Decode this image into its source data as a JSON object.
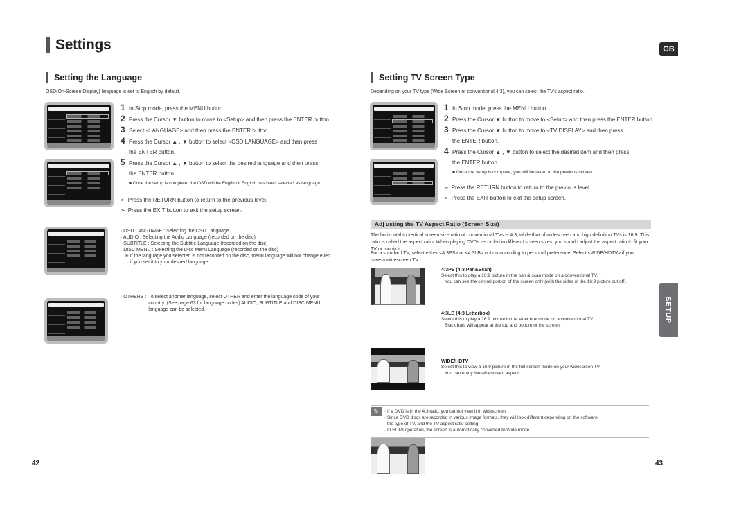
{
  "page": {
    "title": "Settings",
    "region_badge": "GB",
    "side_tab": "SETUP",
    "page_left": "42",
    "page_right": "43"
  },
  "language": {
    "heading": "Setting the Language",
    "intro": "OSD(On-Screen Display) language is set to English by default.",
    "steps": [
      {
        "num": "1",
        "text": "In Stop mode, press the MENU button."
      },
      {
        "num": "2",
        "text": "Press the Cursor ▼ button to move to <Setup> and then press the ENTER button."
      },
      {
        "num": "3",
        "text": "Select <LANGUAGE> and then press the ENTER button."
      },
      {
        "num": "4",
        "text": "Press the Cursor ▲ , ▼ button to select <OSD LANGUAGE> and then press",
        "cont": "the ENTER button."
      },
      {
        "num": "5",
        "text": "Press the Cursor ▲ , ▼ button to select the desired language and then press",
        "cont": "the ENTER button."
      }
    ],
    "step5_note": "■  Once the setup is complete, the OSD will be English if English has been selected as language.",
    "tips": [
      "Press the RETURN button to return to the previous level.",
      "Press the EXIT button to exit the setup screen."
    ],
    "bullets": [
      "· OSD LANGUAGE : Selecting the OSD Language",
      "· AUDIO : Selecting the Audio Language (recorded on the disc)",
      "· SUBTITLE : Selecting the Subtitle Language (recorded on the disc)",
      "· DISC MENU : Selecting the Disc Menu Language (recorded on the disc)"
    ],
    "bullet_note_1": "※ If the language you selected is not recorded on the disc, menu language will not change even",
    "bullet_note_2": "if you set it to your desired language.",
    "others_label": "· OTHERS :",
    "others_text": "To select another language, select OTHER and enter the language code of your country. (See page 63 for language codes) AUDIO, SUBTITLE and DISC MENU language can be selected."
  },
  "tv_screen": {
    "heading": "Setting TV Screen Type",
    "intro": "Depending on your TV type (Wide Screen or conventional 4:3), you can select the TV's aspect ratio.",
    "steps": [
      {
        "num": "1",
        "text": "In Stop mode, press the MENU button."
      },
      {
        "num": "2",
        "text": "Press the Cursor ▼ button to move to <Setup> and then press the ENTER button."
      },
      {
        "num": "3",
        "text": "Press the Cursor ▼ button to move to <TV DISPLAY> and then press",
        "cont": "the ENTER button."
      },
      {
        "num": "4",
        "text": "Press the Cursor ▲ , ▼ button to select the desired item and then press",
        "cont": "the ENTER button."
      }
    ],
    "step4_note": "■  Once the setup is complete, you will be taken to the previous screen.",
    "tips": [
      "Press the RETURN button to return to the previous level.",
      "Press the EXIT button to exit the setup screen."
    ],
    "aspect_heading": "Adj  usting the TV Aspect Ratio (Screen Size)",
    "aspect_para1": "The horizontal to vertical screen size ratio of conventional TVs is 4:3, while that of widescreen and high definition TVs is 16:9. This ratio is called the aspect ratio. When playing DVDs recorded in different screen sizes, you should adjust the aspect ratio to fit your TV or monitor.",
    "aspect_para2": "For a standard TV, select either <4:3PS> or <4:3LB> option according to personal preference. Select <WIDE/HDTV> if you have a widescreen TV.",
    "options": [
      {
        "title": "4:3PS (4:3 Pan&Scan)",
        "line1": "Select this to play a 16:9 picture in the pan & scan mode on a conventional TV.",
        "line2": "You can see the central portion of the screen only (with the sides of the 16:9 picture cut off)."
      },
      {
        "title": "4:3LB (4:3 Letterbox)",
        "line1": "Select this to play a 16:9 picture in the letter box mode on a conventional TV.",
        "line2": "Black bars will appear at the top and bottom of the screen."
      },
      {
        "title": "WIDE/HDTV",
        "line1": "Select this to view a 16:9 picture in the full-screen mode on your widescreen TV.",
        "line2": "You can enjoy the widescreen aspect."
      }
    ],
    "notes": [
      "· If a DVD is in the 4:3 ratio, you cannot view it in widescreen.",
      "· Since DVD discs are recorded in various image formats, they will look different depending on the software,",
      "the type of TV, and the TV aspect ratio setting.",
      "· In HDMI operation, the screen is automatically converted to Wide mode."
    ]
  }
}
